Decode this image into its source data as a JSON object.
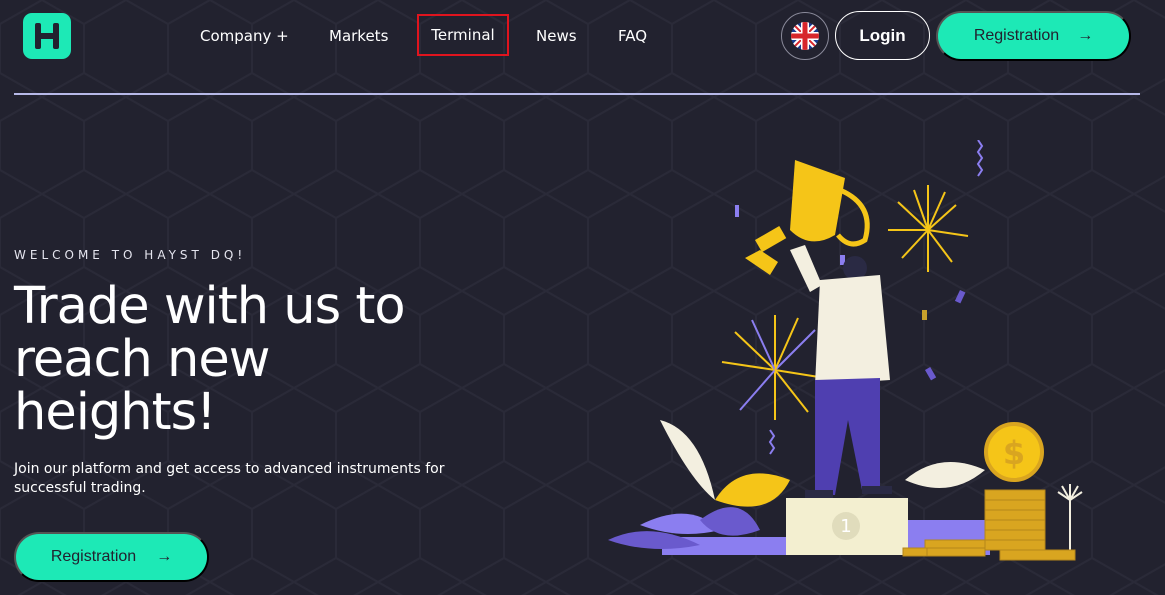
{
  "header": {
    "logo_icon": "brand-logo-icon",
    "nav": {
      "company": "Company +",
      "markets": "Markets",
      "terminal": "Terminal",
      "news": "News",
      "faq": "FAQ"
    },
    "language_icon": "uk-flag-icon",
    "login_label": "Login",
    "registration_label": "Registration",
    "arrow": "→"
  },
  "hero": {
    "eyebrow": "WELCOME TO HAYST DQ!",
    "headline": "Trade with us to reach new heights!",
    "subtext": "Join our platform and get access to advanced instruments for successful trading.",
    "cta_label": "Registration",
    "cta_arrow": "→"
  },
  "illustration": {
    "podium_number": "1",
    "coin_symbol": "$"
  },
  "colors": {
    "background": "#22222f",
    "accent": "#1de9b6",
    "divider": "#b7b9e8",
    "highlight_border": "#e0141e",
    "gold": "#f5c518",
    "purple": "#6a5acd"
  }
}
